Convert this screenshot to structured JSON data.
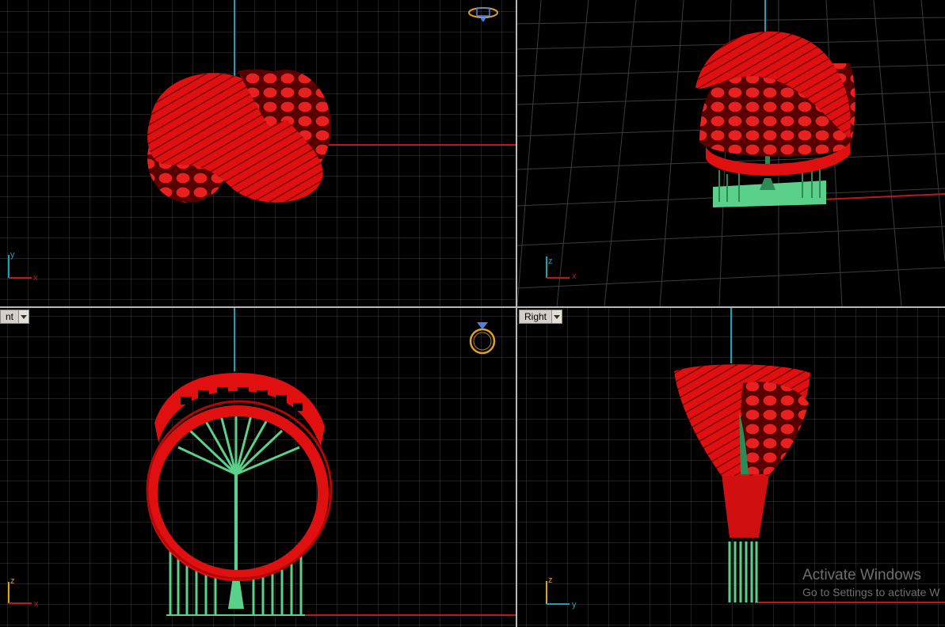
{
  "viewports": {
    "top": {
      "label": "",
      "axes": {
        "h": "x",
        "v": "y"
      }
    },
    "perspective": {
      "label": "",
      "axes": {
        "h": "x",
        "v": "z"
      }
    },
    "front": {
      "label": "nt",
      "axes": {
        "h": "x",
        "v": "z"
      }
    },
    "right": {
      "label": "Right",
      "axes": {
        "h": "y",
        "v": "z"
      }
    }
  },
  "watermark": {
    "title": "Activate Windows",
    "subtitle": "Go to Settings to activate W"
  },
  "colors": {
    "background": "#000000",
    "grid": "#3c3c3c",
    "model": "#e01010",
    "supports": "#5bd08a",
    "axis_x": "#c01818",
    "axis_y": "#20a0b0"
  },
  "icons": [
    "ring-gizmo-icon",
    "ring-gizmo-icon",
    "viewport-menu-arrow-icon"
  ]
}
